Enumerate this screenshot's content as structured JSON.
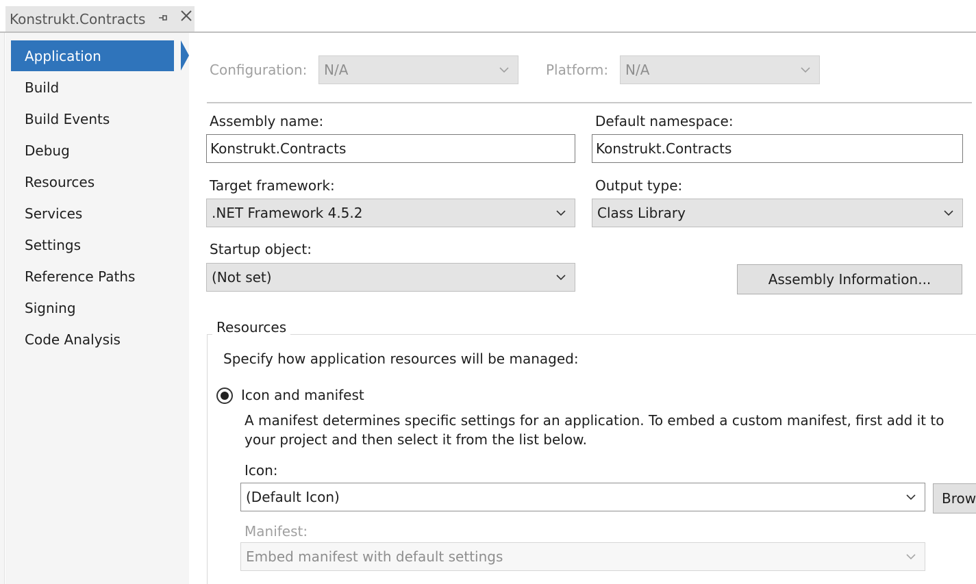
{
  "document_tab": {
    "title": "Konstrukt.Contracts",
    "pin_icon": "pin-icon",
    "close_icon": "close-icon"
  },
  "sidebar": {
    "items": [
      {
        "label": "Application",
        "selected": true
      },
      {
        "label": "Build"
      },
      {
        "label": "Build Events"
      },
      {
        "label": "Debug"
      },
      {
        "label": "Resources"
      },
      {
        "label": "Services"
      },
      {
        "label": "Settings"
      },
      {
        "label": "Reference Paths"
      },
      {
        "label": "Signing"
      },
      {
        "label": "Code Analysis"
      }
    ]
  },
  "config_bar": {
    "configuration_label": "Configuration:",
    "configuration_value": "N/A",
    "platform_label": "Platform:",
    "platform_value": "N/A"
  },
  "form": {
    "assembly_name_label": "Assembly name:",
    "assembly_name_value": "Konstrukt.Contracts",
    "default_namespace_label": "Default namespace:",
    "default_namespace_value": "Konstrukt.Contracts",
    "target_framework_label": "Target framework:",
    "target_framework_value": ".NET Framework 4.5.2",
    "output_type_label": "Output type:",
    "output_type_value": "Class Library",
    "startup_object_label": "Startup object:",
    "startup_object_value": "(Not set)",
    "assembly_info_button": "Assembly Information..."
  },
  "resources": {
    "group_title": "Resources",
    "instructions": "Specify how application resources will be managed:",
    "icon_manifest_option": "Icon and manifest",
    "manifest_description": "A manifest determines specific settings for an application. To embed a custom manifest, first add it to your project and then select it from the list below.",
    "icon_label": "Icon:",
    "icon_value": "(Default Icon)",
    "browse_button": "Brow",
    "manifest_label": "Manifest:",
    "manifest_value": "Embed manifest with default settings"
  },
  "colors": {
    "accent": "#2f74bb",
    "sidebar_bg": "#f5f5f5"
  }
}
